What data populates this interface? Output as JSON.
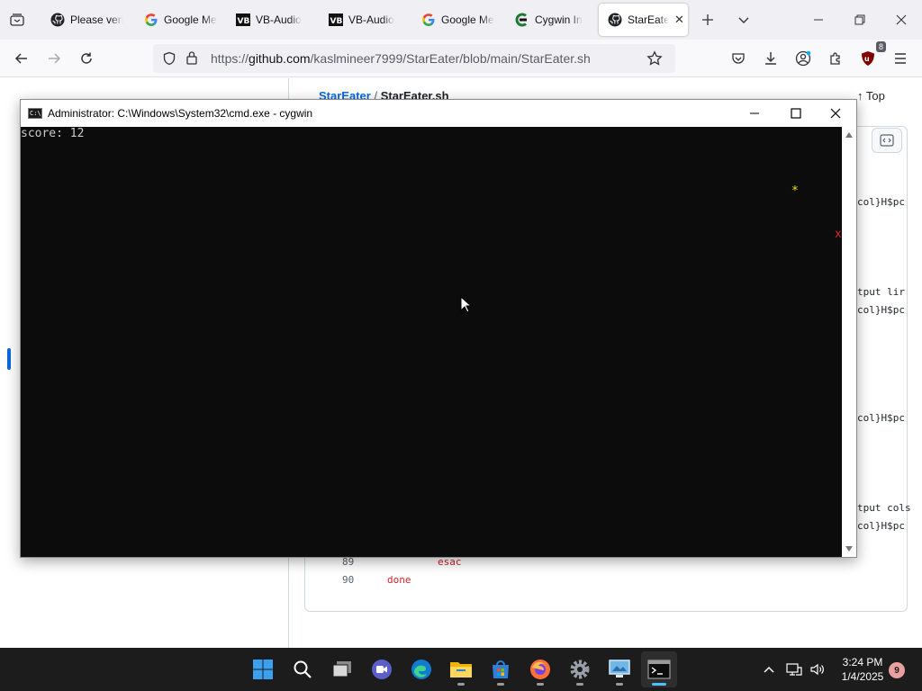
{
  "browser": {
    "tabs": [
      {
        "title": "Please veri",
        "icon": "github-icon"
      },
      {
        "title": "Google Me",
        "icon": "google-icon"
      },
      {
        "title": "VB-Audio",
        "icon": "vb-audio-icon"
      },
      {
        "title": "VB-Audio",
        "icon": "vb-audio-icon"
      },
      {
        "title": "Google Me",
        "icon": "google-icon"
      },
      {
        "title": "Cygwin In",
        "icon": "cygwin-icon"
      },
      {
        "title": "StarEate",
        "icon": "github-icon",
        "active": true
      }
    ],
    "url": {
      "prefix": "https://",
      "domain": "github.com",
      "path": "/kaslmineer7999/StarEater/blob/main/StarEater.sh"
    },
    "extensions_badge": "8"
  },
  "github": {
    "repo": "StarEater",
    "separator": "/",
    "file": "StarEater.sh",
    "top_label": "Top",
    "code_fragments": [
      "col}H$pc",
      "tput lir",
      "col}H$pc",
      "col}H$pc",
      "tput cols",
      "col}H$pc"
    ],
    "code_lines": [
      {
        "number": "89",
        "code": "esac"
      },
      {
        "number": "90",
        "code": "done"
      }
    ]
  },
  "cmd_window": {
    "title": "Administrator: C:\\Windows\\System32\\cmd.exe - cygwin",
    "icon_label": "C:\\",
    "score_line": "score: 12",
    "star_char": "*",
    "enemy_char": "x",
    "colors": {
      "background": "#0c0c0c",
      "text": "#cccccc",
      "star": "#ffe000",
      "enemy": "#e01b24"
    }
  },
  "taskbar": {
    "apps": [
      "start-icon",
      "search-icon",
      "task-view-icon",
      "meet-icon",
      "edge-icon",
      "file-explorer-icon",
      "store-icon",
      "firefox-icon",
      "settings-icon",
      "remote-desktop-icon",
      "terminal-icon"
    ],
    "active_app": "terminal-icon",
    "time": "3:24 PM",
    "date": "1/4/2025",
    "notifications": "9"
  },
  "colors": {
    "accent": "#0969da",
    "taskbar": "#1c1c1c",
    "keyword": "#cf222e"
  }
}
